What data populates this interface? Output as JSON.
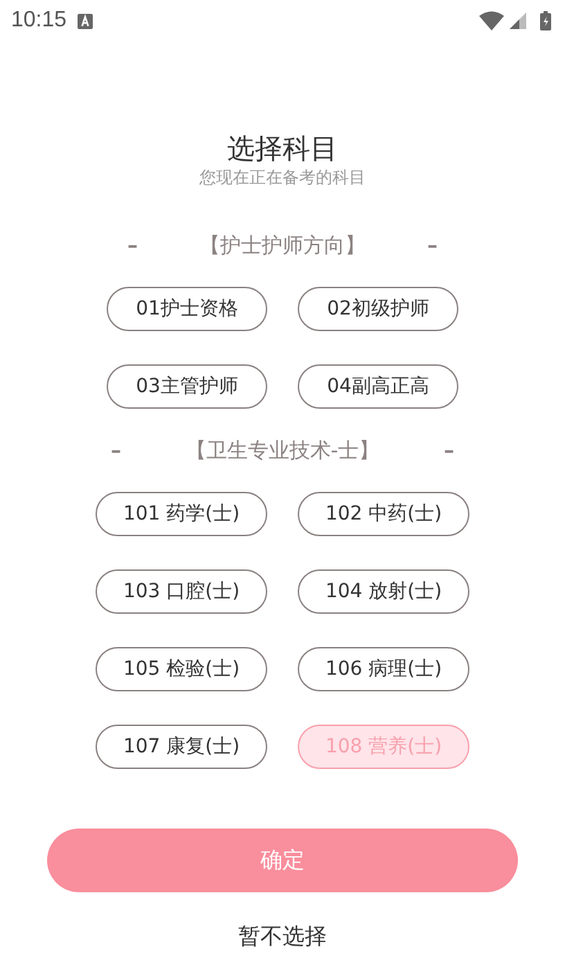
{
  "status_bar": {
    "time": "10:15"
  },
  "title": "选择科目",
  "subtitle": "您现在正在备考的科目",
  "sections": [
    {
      "dash_left": "–",
      "heading": "【护士护师方向】",
      "dash_right": "–",
      "items": [
        {
          "label": "01护士资格",
          "selected": false
        },
        {
          "label": "02初级护师",
          "selected": false
        },
        {
          "label": "03主管护师",
          "selected": false
        },
        {
          "label": "04副高正高",
          "selected": false
        }
      ]
    },
    {
      "dash_left": "–",
      "heading": "【卫生专业技术-士】",
      "dash_right": "–",
      "items": [
        {
          "label": "101 药学(士)",
          "selected": false
        },
        {
          "label": "102 中药(士)",
          "selected": false
        },
        {
          "label": "103 口腔(士)",
          "selected": false
        },
        {
          "label": "104 放射(士)",
          "selected": false
        },
        {
          "label": "105 检验(士)",
          "selected": false
        },
        {
          "label": "106 病理(士)",
          "selected": false
        },
        {
          "label": "107 康复(士)",
          "selected": false
        },
        {
          "label": "108 营养(士)",
          "selected": true
        }
      ]
    }
  ],
  "confirm": "确定",
  "skip": "暂不选择"
}
